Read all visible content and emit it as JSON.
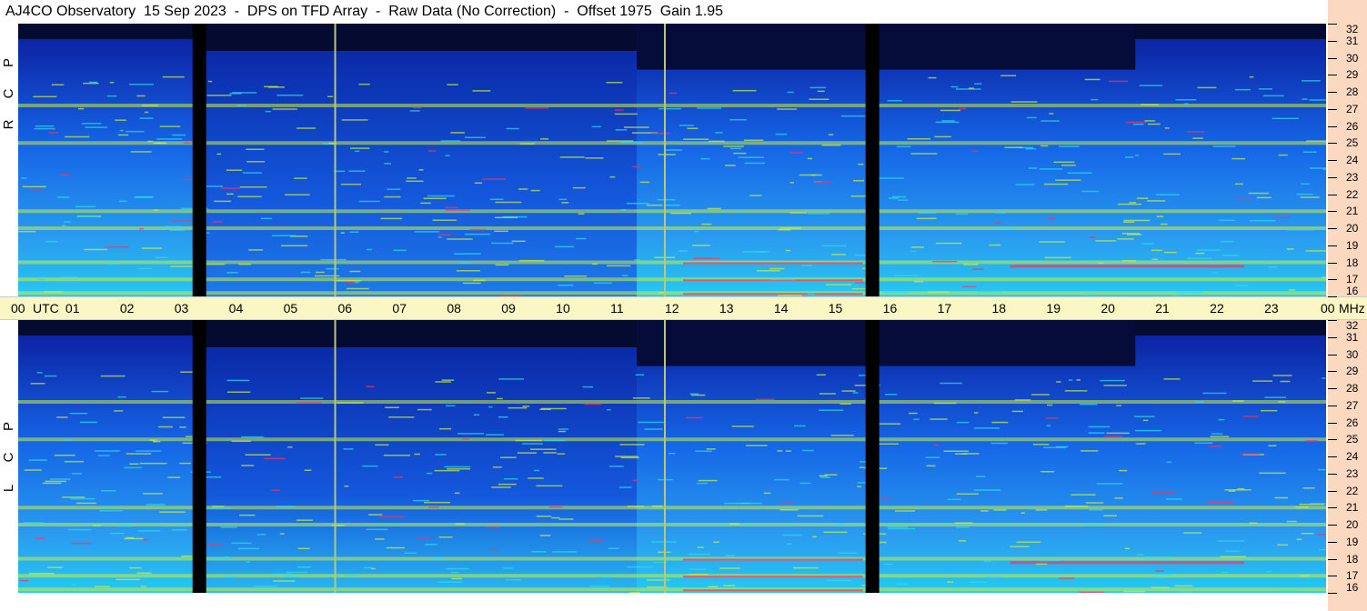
{
  "title": "AJ4CO Observatory  15 Sep 2023  -  DPS on TFD Array  -  Raw Data (No Correction)  -  Offset 1975  Gain 1.95",
  "panels": [
    {
      "id": "top",
      "side_label": [
        "R",
        "C",
        "P"
      ]
    },
    {
      "id": "bottom",
      "side_label": [
        "L",
        "C",
        "P"
      ]
    }
  ],
  "time_axis": {
    "unit_label": "UTC",
    "ticks": [
      "00",
      "01",
      "02",
      "03",
      "04",
      "05",
      "06",
      "07",
      "08",
      "09",
      "10",
      "11",
      "12",
      "13",
      "14",
      "15",
      "16",
      "17",
      "18",
      "19",
      "20",
      "21",
      "22",
      "23",
      "00"
    ]
  },
  "freq_axis": {
    "unit_label": "MHz",
    "ticks": [
      "32",
      "31",
      "30",
      "29",
      "28",
      "27",
      "26",
      "25",
      "24",
      "23",
      "22",
      "21",
      "20",
      "19",
      "18",
      "17",
      "16"
    ]
  },
  "colors": {
    "background_low": "#0a1a9a",
    "background_mid": "#1565e6",
    "background_high": "#28c8f0",
    "interference": "#c8f040",
    "hot": "#ff3060",
    "gap": "#000000",
    "time_band": "#fbf7c4",
    "axis_band": "#fbd9c0"
  },
  "chart_data": {
    "type": "heatmap",
    "title": "AJ4CO Observatory  15 Sep 2023  -  DPS on TFD Array  -  Raw Data (No Correction)  -  Offset 1975  Gain 1.95",
    "xlabel": "UTC",
    "ylabel": "MHz",
    "x_range": [
      0,
      24
    ],
    "y_range": [
      16,
      32
    ],
    "series": [
      {
        "name": "RCP"
      },
      {
        "name": "LCP"
      }
    ],
    "data_gaps_utc": [
      [
        3.2,
        3.45
      ],
      [
        15.55,
        15.8
      ]
    ],
    "vertical_markers_utc": [
      5.8,
      11.85
    ],
    "interference_bands_mhz": [
      27.2,
      25.0,
      21.0,
      20.0,
      18.0,
      17.0,
      16.2
    ]
  }
}
